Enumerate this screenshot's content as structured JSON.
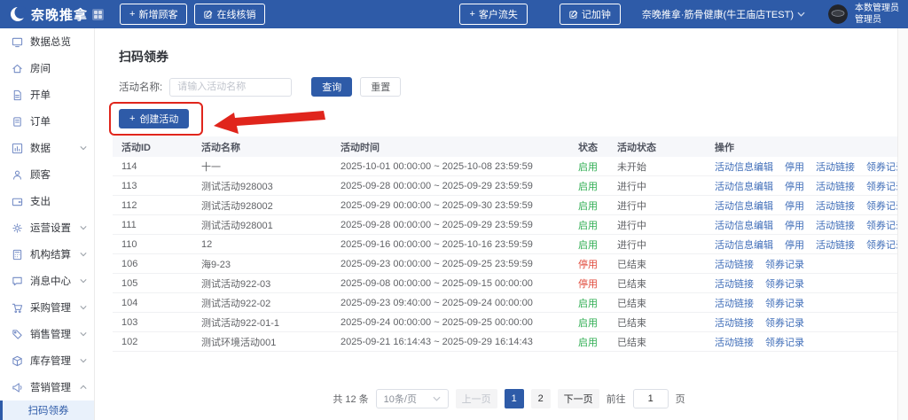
{
  "colors": {
    "primary": "#2e5ba8",
    "link": "#3f6db8",
    "status_enabled": "#2fad52",
    "status_disabled": "#e14b3c",
    "annotation_red": "#e0251c"
  },
  "navbar": {
    "logo_text": "奈晚推拿",
    "new_customer_button": "新增顾客",
    "online_verify_button": "在线核销",
    "customer_loss_button": "客户流失",
    "record_overtime_button": "记加钟",
    "store_name": "奈晚推拿·筋骨健康(牛王庙店TEST)",
    "user_name": "本数管理员",
    "user_role": "管理员"
  },
  "sidebar": {
    "items": [
      {
        "label": "数据总览",
        "icon": "dashboard",
        "chevron": ""
      },
      {
        "label": "房间",
        "icon": "home",
        "chevron": ""
      },
      {
        "label": "开单",
        "icon": "doc",
        "chevron": ""
      },
      {
        "label": "订单",
        "icon": "order",
        "chevron": ""
      },
      {
        "label": "数据",
        "icon": "chart",
        "chevron": "down"
      },
      {
        "label": "顾客",
        "icon": "user",
        "chevron": ""
      },
      {
        "label": "支出",
        "icon": "wallet",
        "chevron": ""
      },
      {
        "label": "运营设置",
        "icon": "gear",
        "chevron": "down"
      },
      {
        "label": "机构结算",
        "icon": "calc",
        "chevron": "down"
      },
      {
        "label": "消息中心",
        "icon": "message",
        "chevron": "down"
      },
      {
        "label": "采购管理",
        "icon": "cart",
        "chevron": "down"
      },
      {
        "label": "销售管理",
        "icon": "sale",
        "chevron": "down"
      },
      {
        "label": "库存管理",
        "icon": "box",
        "chevron": "down"
      },
      {
        "label": "营销管理",
        "icon": "marketing",
        "chevron": "up"
      }
    ],
    "active_subitem": "扫码领券"
  },
  "main": {
    "page_title": "扫码领券",
    "filter": {
      "label": "活动名称:",
      "placeholder": "请输入活动名称",
      "search_button": "查询",
      "reset_button": "重置"
    },
    "create_button": "创建活动"
  },
  "table": {
    "headers": [
      "活动ID",
      "活动名称",
      "活动时间",
      "状态",
      "活动状态",
      "操作"
    ],
    "rows": [
      {
        "id": "114",
        "name": "十一",
        "time": "2025-10-01 00:00:00 ~ 2025-10-08 23:59:59",
        "status": "启用",
        "status_type": "enabled",
        "activity_status": "未开始",
        "actions": [
          "活动信息编辑",
          "停用",
          "活动链接",
          "领券记录"
        ]
      },
      {
        "id": "113",
        "name": "测试活动928003",
        "time": "2025-09-28 00:00:00 ~ 2025-09-29 23:59:59",
        "status": "启用",
        "status_type": "enabled",
        "activity_status": "进行中",
        "actions": [
          "活动信息编辑",
          "停用",
          "活动链接",
          "领券记录"
        ]
      },
      {
        "id": "112",
        "name": "测试活动928002",
        "time": "2025-09-29 00:00:00 ~ 2025-09-30 23:59:59",
        "status": "启用",
        "status_type": "enabled",
        "activity_status": "进行中",
        "actions": [
          "活动信息编辑",
          "停用",
          "活动链接",
          "领券记录"
        ]
      },
      {
        "id": "111",
        "name": "测试活动928001",
        "time": "2025-09-28 00:00:00 ~ 2025-09-29 23:59:59",
        "status": "启用",
        "status_type": "enabled",
        "activity_status": "进行中",
        "actions": [
          "活动信息编辑",
          "停用",
          "活动链接",
          "领券记录"
        ]
      },
      {
        "id": "110",
        "name": "12",
        "time": "2025-09-16 00:00:00 ~ 2025-10-16 23:59:59",
        "status": "启用",
        "status_type": "enabled",
        "activity_status": "进行中",
        "actions": [
          "活动信息编辑",
          "停用",
          "活动链接",
          "领券记录"
        ]
      },
      {
        "id": "106",
        "name": "海9-23",
        "time": "2025-09-23 00:00:00 ~ 2025-09-25 23:59:59",
        "status": "停用",
        "status_type": "disabled",
        "activity_status": "已结束",
        "actions": [
          "活动链接",
          "领券记录"
        ]
      },
      {
        "id": "105",
        "name": "测试活动922-03",
        "time": "2025-09-08 00:00:00 ~ 2025-09-15 00:00:00",
        "status": "停用",
        "status_type": "disabled",
        "activity_status": "已结束",
        "actions": [
          "活动链接",
          "领券记录"
        ]
      },
      {
        "id": "104",
        "name": "测试活动922-02",
        "time": "2025-09-23 09:40:00 ~ 2025-09-24 00:00:00",
        "status": "启用",
        "status_type": "enabled",
        "activity_status": "已结束",
        "actions": [
          "活动链接",
          "领券记录"
        ]
      },
      {
        "id": "103",
        "name": "测试活动922-01-1",
        "time": "2025-09-24 00:00:00 ~ 2025-09-25 00:00:00",
        "status": "启用",
        "status_type": "enabled",
        "activity_status": "已结束",
        "actions": [
          "活动链接",
          "领券记录"
        ]
      },
      {
        "id": "102",
        "name": "测试环境活动001",
        "time": "2025-09-21 16:14:43 ~ 2025-09-29 16:14:43",
        "status": "启用",
        "status_type": "enabled",
        "activity_status": "已结束",
        "actions": [
          "活动链接",
          "领券记录"
        ]
      }
    ]
  },
  "pagination": {
    "total_text": "共 12 条",
    "page_size": "10条/页",
    "prev_label": "上一页",
    "pages": [
      "1",
      "2"
    ],
    "active_page": "1",
    "next_label": "下一页",
    "goto_prefix": "前往",
    "goto_value": "1",
    "goto_suffix": "页"
  }
}
